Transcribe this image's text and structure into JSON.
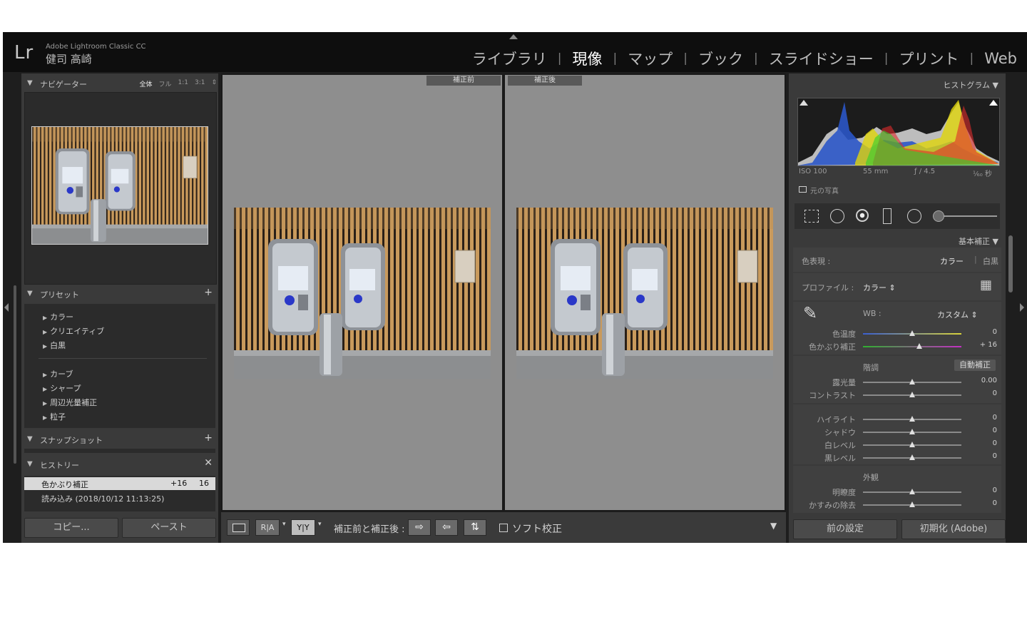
{
  "app": {
    "logo": "Lr",
    "name": "Adobe Lightroom Classic CC",
    "user": "健司 高崎"
  },
  "modules": [
    "ライブラリ",
    "現像",
    "マップ",
    "ブック",
    "スライドショー",
    "プリント",
    "Web"
  ],
  "left": {
    "navigator": {
      "title": "ナビゲーター",
      "zoom": [
        "全体",
        "フル",
        "1:1",
        "3:1"
      ]
    },
    "presets": {
      "title": "プリセット",
      "items_a": [
        "カラー",
        "クリエイティブ",
        "白黒"
      ],
      "items_b": [
        "カーブ",
        "シャープ",
        "周辺光量補正",
        "粒子"
      ]
    },
    "snapshot": {
      "title": "スナップショット"
    },
    "history": {
      "title": "ヒストリー",
      "rows": [
        {
          "name": "色かぶり補正",
          "delta": "+16",
          "value": "16"
        },
        {
          "name": "読み込み (2018/10/12 11:13:25)",
          "delta": "",
          "value": ""
        }
      ]
    },
    "copy_button": "コピー...",
    "paste_button": "ペースト"
  },
  "center": {
    "before_label": "補正前",
    "after_label": "補正後",
    "toolbar": {
      "ra": "R|A",
      "yy": "Y|Y",
      "compare_label": "補正前と補正後 :",
      "soft_proof": "ソフト校正"
    }
  },
  "right": {
    "histogram": {
      "title": "ヒストグラム",
      "iso": "ISO 100",
      "focal": "55 mm",
      "aperture": "ƒ / 4.5",
      "shutter": "¹⁄₆₀ 秒",
      "original_photo": "元の写真"
    },
    "basic": {
      "title": "基本補正",
      "treatment_label": "色表現 :",
      "treatment_color": "カラー",
      "treatment_bw": "白黒",
      "profile_label": "プロファイル :",
      "profile_value": "カラー",
      "wb_label": "WB :",
      "wb_value": "カスタム",
      "temp_label": "色温度",
      "temp_value": "0",
      "tint_label": "色かぶり補正",
      "tint_value": "+ 16",
      "tone_label": "階調",
      "auto_button": "自動補正",
      "exposure_label": "露光量",
      "exposure_value": "0.00",
      "contrast_label": "コントラスト",
      "contrast_value": "0",
      "highlights_label": "ハイライト",
      "highlights_value": "0",
      "shadows_label": "シャドウ",
      "shadows_value": "0",
      "whites_label": "白レベル",
      "whites_value": "0",
      "blacks_label": "黒レベル",
      "blacks_value": "0",
      "presence_label": "外観",
      "clarity_label": "明瞭度",
      "clarity_value": "0",
      "dehaze_label": "かすみの除去",
      "dehaze_value": "0"
    },
    "previous_button": "前の設定",
    "reset_button": "初期化 (Adobe)"
  }
}
